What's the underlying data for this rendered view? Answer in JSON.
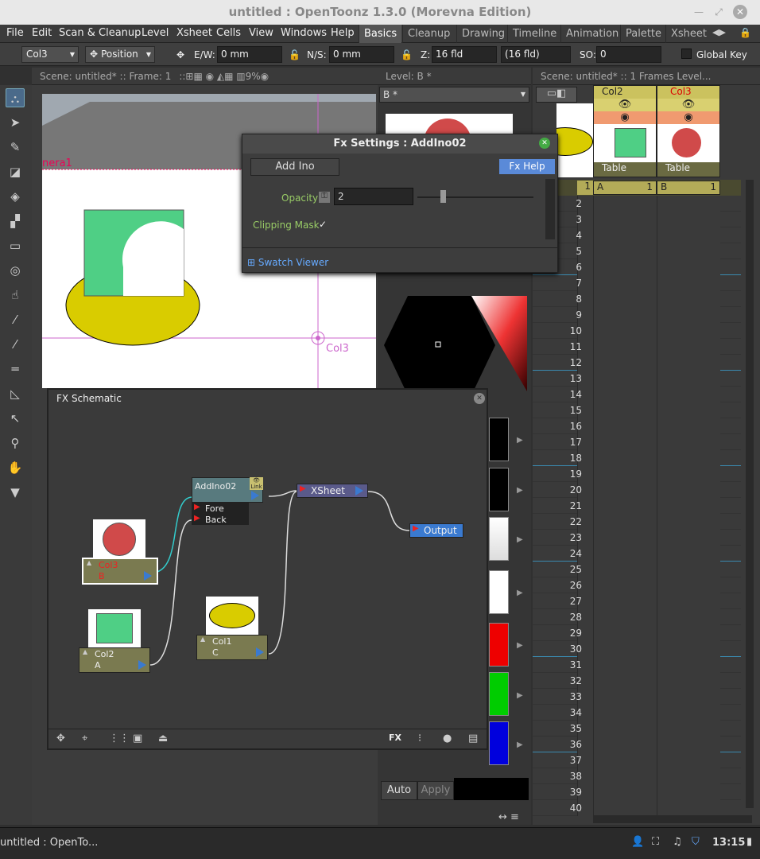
{
  "window": {
    "title": "untitled : OpenToonz 1.3.0 (Morevna Edition)"
  },
  "menu": {
    "items": [
      "File",
      "Edit",
      "Scan & Cleanup",
      "Level",
      "Xsheet",
      "Cells",
      "View",
      "Windows",
      "Help"
    ],
    "rooms": [
      "Basics",
      "Cleanup",
      "Drawing",
      "Timeline",
      "Animation",
      "Palette",
      "Xsheet"
    ],
    "active_room": "Basics"
  },
  "tool_options": {
    "object": "Col3",
    "mode": "Position",
    "ew_label": "E/W:",
    "ew_value": "0 mm",
    "ns_label": "N/S:",
    "ns_value": "0 mm",
    "z_label": "Z:",
    "z_value": "16 fld",
    "z2_value": "16 fld",
    "so_label": "SO:",
    "so_value": "0",
    "global_key": "Global Key"
  },
  "viewer": {
    "header": "Scene: untitled*   ::   Frame: 1",
    "camera_label": "nera1",
    "col_label": "Col3"
  },
  "level_strip": {
    "header": "Level:  B *",
    "combo": "B *",
    "auto": "Auto",
    "apply": "Apply"
  },
  "xsheet": {
    "header": "Scene: untitled*   ::   1 Frames  Level...",
    "columns": [
      {
        "name": "Col2",
        "level": "Table",
        "cell": "A",
        "num": "1"
      },
      {
        "name": "Col3",
        "level": "Table",
        "cell": "B",
        "num": "1"
      }
    ],
    "frame_col_num": "1",
    "rows": [
      "1",
      "2",
      "3",
      "4",
      "5",
      "6",
      "7",
      "8",
      "9",
      "10",
      "11",
      "12",
      "13",
      "14",
      "15",
      "16",
      "17",
      "18",
      "19",
      "20",
      "21",
      "22",
      "23",
      "24",
      "25",
      "26",
      "27",
      "28",
      "29",
      "30",
      "31",
      "32",
      "33",
      "34",
      "35",
      "36",
      "37",
      "38",
      "39",
      "40"
    ]
  },
  "fx_settings": {
    "title": "Fx Settings : AddIno02",
    "tab": "Add Ino",
    "help": "Fx Help",
    "opacity_label": "Opacity",
    "opacity_value": "2",
    "opacity_slider": 0.2,
    "clip_label": "Clipping Mask",
    "clip_check": "✓",
    "swatch": "Swatch Viewer"
  },
  "fx_schematic": {
    "title": "FX Schematic",
    "addino": "AddIno02",
    "link": "Link",
    "fore": "Fore",
    "back": "Back",
    "xsheet": "XSheet",
    "output": "Output",
    "col3": "Col3",
    "col3_level": "B",
    "col2": "Col2",
    "col2_level": "A",
    "col1": "Col1",
    "col1_level": "C",
    "fx_btn": "FX"
  },
  "taskbar": {
    "app": "untitled : OpenTo...",
    "time": "13:15"
  },
  "colors": {
    "green": "#4fcf85",
    "yellow": "#d9cc00",
    "red": "#d04a4a",
    "accent": "#3a7ad0"
  }
}
